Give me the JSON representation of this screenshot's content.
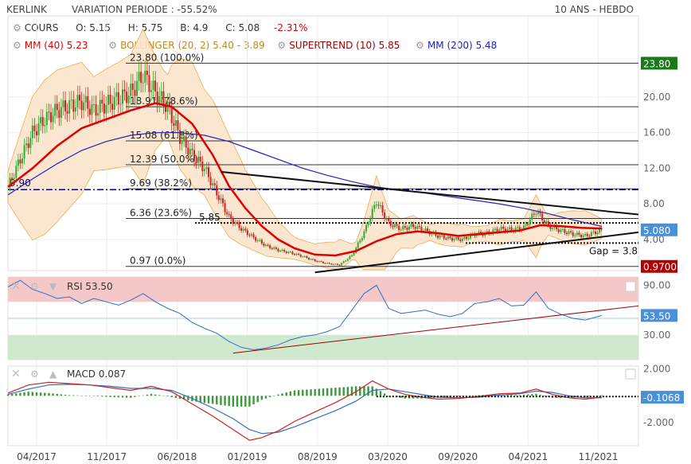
{
  "header": {
    "ticker": "KERLINK",
    "variation_label": "VARIATION PERIODE : -55.52%",
    "period": "10 ANS - HEBDO"
  },
  "legend": {
    "row1": {
      "cours": "COURS",
      "open": "O: 5.15",
      "high": "H: 5.75",
      "low": "B: 4.9",
      "close": "C: 5.08",
      "change": "-2.31%"
    },
    "row2": {
      "mm40_label": "MM (40)",
      "mm40_value": "5.23",
      "boll_label": "BOLLINGER (20, 2)",
      "boll_value": "5.40 - 3.89",
      "st_label": "SUPERTREND (10)",
      "st_value": "5.85",
      "mm200_label": "MM (200)",
      "mm200_value": "5.48"
    }
  },
  "colors": {
    "mm40": "#e00000",
    "bollinger": "#e8a030",
    "supertrend": "#a00000",
    "mm200": "#2020c0",
    "up": "#33aa33",
    "down": "#cc2222",
    "rsi_top": "#f4c8c8",
    "rsi_bottom": "#cfe9cf",
    "macd": "#cc2222",
    "signal": "#3070c0"
  },
  "chart_data": [
    {
      "type": "candlestick",
      "title": "KERLINK",
      "x_ticks": [
        "04/2017",
        "11/2017",
        "06/2018",
        "01/2019",
        "08/2019",
        "03/2020",
        "09/2020",
        "04/2021",
        "11/2021"
      ],
      "y_ticks": [
        "4.00",
        "8.00",
        "12.00",
        "16.00",
        "20.00"
      ],
      "ylim": [
        0.5,
        25
      ],
      "price_badges": {
        "max": "23.80",
        "last": "5.080",
        "min": "0.9700"
      },
      "left_label": "9.90",
      "fibonacci": [
        {
          "label": "23.80  (100.0%)",
          "value": 23.8
        },
        {
          "label": "18.91  (78.6%)",
          "value": 18.91
        },
        {
          "label": "15.08  (61.8%)",
          "value": 15.08
        },
        {
          "label": "12.39  (50.0%)",
          "value": 12.39
        },
        {
          "label": "9.69  (38.2%)",
          "value": 9.69
        },
        {
          "label": "6.36  (23.6%)",
          "value": 6.36
        },
        {
          "label": "0.97  (0.0%)",
          "value": 0.97
        }
      ],
      "supertrend_level": {
        "label": "5.85",
        "value": 5.85
      },
      "gap_label": "Gap = 3.8",
      "close_series": [
        [
          0,
          9.9
        ],
        [
          6,
          13
        ],
        [
          12,
          16
        ],
        [
          18,
          17.5
        ],
        [
          24,
          18.5
        ],
        [
          30,
          19
        ],
        [
          36,
          19.5
        ],
        [
          42,
          18.5
        ],
        [
          48,
          19.2
        ],
        [
          54,
          19.8
        ],
        [
          60,
          20.5
        ],
        [
          66,
          22.5
        ],
        [
          72,
          20.5
        ],
        [
          78,
          18.9
        ],
        [
          84,
          15.5
        ],
        [
          90,
          13.5
        ],
        [
          96,
          12
        ],
        [
          102,
          9.2
        ],
        [
          108,
          6.5
        ],
        [
          114,
          5.2
        ],
        [
          120,
          4.2
        ],
        [
          126,
          3.3
        ],
        [
          132,
          2.8
        ],
        [
          138,
          2.5
        ],
        [
          144,
          2.1
        ],
        [
          150,
          1.6
        ],
        [
          156,
          1.3
        ],
        [
          162,
          1.15
        ],
        [
          168,
          2.2
        ],
        [
          174,
          4.8
        ],
        [
          180,
          8.3
        ],
        [
          186,
          5.8
        ],
        [
          192,
          5.2
        ],
        [
          198,
          5.5
        ],
        [
          204,
          5.0
        ],
        [
          210,
          4.4
        ],
        [
          216,
          4.1
        ],
        [
          222,
          4.0
        ],
        [
          228,
          4.6
        ],
        [
          234,
          4.7
        ],
        [
          240,
          5.2
        ],
        [
          246,
          5.1
        ],
        [
          252,
          5.3
        ],
        [
          258,
          7.2
        ],
        [
          264,
          5.5
        ],
        [
          270,
          5.0
        ],
        [
          276,
          4.6
        ],
        [
          282,
          4.4
        ],
        [
          288,
          4.9
        ],
        [
          290,
          5.08
        ]
      ],
      "mm40": [
        [
          0,
          9.9
        ],
        [
          12,
          12
        ],
        [
          24,
          14.5
        ],
        [
          36,
          16.5
        ],
        [
          48,
          17.5
        ],
        [
          60,
          18.5
        ],
        [
          72,
          19.3
        ],
        [
          80,
          18.9
        ],
        [
          90,
          17
        ],
        [
          100,
          13.5
        ],
        [
          108,
          10
        ],
        [
          116,
          7.5
        ],
        [
          124,
          5.5
        ],
        [
          132,
          4
        ],
        [
          140,
          3
        ],
        [
          150,
          2.3
        ],
        [
          160,
          2.2
        ],
        [
          170,
          2.7
        ],
        [
          180,
          3.8
        ],
        [
          190,
          4.6
        ],
        [
          200,
          4.9
        ],
        [
          210,
          4.7
        ],
        [
          220,
          4.4
        ],
        [
          230,
          4.6
        ],
        [
          240,
          4.8
        ],
        [
          250,
          5.0
        ],
        [
          260,
          5.6
        ],
        [
          270,
          5.5
        ],
        [
          280,
          5.3
        ],
        [
          290,
          5.23
        ]
      ],
      "mm200": [
        [
          0,
          9.0
        ],
        [
          12,
          10.8
        ],
        [
          24,
          12.5
        ],
        [
          36,
          14.0
        ],
        [
          48,
          15.0
        ],
        [
          60,
          15.7
        ],
        [
          72,
          16.0
        ],
        [
          84,
          16.0
        ],
        [
          96,
          15.7
        ],
        [
          108,
          15.0
        ],
        [
          120,
          14.0
        ],
        [
          132,
          13.0
        ],
        [
          144,
          12.0
        ],
        [
          156,
          11.2
        ],
        [
          168,
          10.5
        ],
        [
          180,
          9.9
        ],
        [
          192,
          9.5
        ],
        [
          204,
          9.2
        ],
        [
          216,
          8.8
        ],
        [
          228,
          8.4
        ],
        [
          240,
          8.0
        ],
        [
          252,
          7.5
        ],
        [
          264,
          6.9
        ],
        [
          276,
          6.2
        ],
        [
          290,
          5.48
        ]
      ],
      "trendlines": [
        {
          "name": "upper",
          "from": [
            104,
            11.6
          ],
          "to": [
            308,
            6.8
          ]
        },
        {
          "name": "lower",
          "from": [
            150,
            0.3
          ],
          "to": [
            308,
            4.8
          ]
        }
      ]
    },
    {
      "type": "line",
      "title": "RSI",
      "value_label": "RSI 53.50",
      "badge": "53.50",
      "y_ticks": [
        "90.00",
        "30.00"
      ],
      "ylim": [
        0,
        100
      ],
      "zones": {
        "overbought": 70,
        "oversold": 30
      },
      "rsi_series": [
        [
          0,
          88
        ],
        [
          6,
          96
        ],
        [
          12,
          85
        ],
        [
          18,
          80
        ],
        [
          24,
          74
        ],
        [
          30,
          76
        ],
        [
          36,
          68
        ],
        [
          42,
          74
        ],
        [
          48,
          70
        ],
        [
          54,
          66
        ],
        [
          60,
          72
        ],
        [
          66,
          80
        ],
        [
          72,
          70
        ],
        [
          78,
          62
        ],
        [
          84,
          56
        ],
        [
          90,
          45
        ],
        [
          96,
          38
        ],
        [
          102,
          32
        ],
        [
          108,
          22
        ],
        [
          114,
          15
        ],
        [
          120,
          12
        ],
        [
          126,
          14
        ],
        [
          132,
          18
        ],
        [
          138,
          24
        ],
        [
          144,
          28
        ],
        [
          150,
          30
        ],
        [
          156,
          34
        ],
        [
          162,
          40
        ],
        [
          168,
          60
        ],
        [
          174,
          80
        ],
        [
          180,
          90
        ],
        [
          186,
          62
        ],
        [
          192,
          56
        ],
        [
          198,
          58
        ],
        [
          204,
          60
        ],
        [
          210,
          55
        ],
        [
          216,
          52
        ],
        [
          222,
          56
        ],
        [
          228,
          68
        ],
        [
          234,
          70
        ],
        [
          240,
          74
        ],
        [
          246,
          65
        ],
        [
          252,
          66
        ],
        [
          258,
          82
        ],
        [
          264,
          62
        ],
        [
          270,
          55
        ],
        [
          276,
          50
        ],
        [
          282,
          48
        ],
        [
          288,
          52
        ],
        [
          290,
          53.5
        ]
      ],
      "trendline": {
        "from": [
          110,
          8
        ],
        "to": [
          308,
          65
        ]
      }
    },
    {
      "type": "line",
      "title": "MACD",
      "value_label": "MACD 0.087",
      "badge": "-0.1068",
      "y_ticks": [
        "2.000",
        "-2.000"
      ],
      "ylim": [
        -3.7,
        2.2
      ],
      "macd_series": [
        [
          0,
          0.2
        ],
        [
          10,
          0.8
        ],
        [
          20,
          1.0
        ],
        [
          30,
          0.9
        ],
        [
          40,
          0.8
        ],
        [
          50,
          0.6
        ],
        [
          60,
          0.4
        ],
        [
          70,
          0.7
        ],
        [
          80,
          0.3
        ],
        [
          90,
          -0.6
        ],
        [
          100,
          -1.5
        ],
        [
          110,
          -2.5
        ],
        [
          118,
          -3.3
        ],
        [
          124,
          -3.1
        ],
        [
          132,
          -2.6
        ],
        [
          140,
          -1.9
        ],
        [
          150,
          -1.2
        ],
        [
          160,
          -0.5
        ],
        [
          170,
          0.3
        ],
        [
          178,
          1.1
        ],
        [
          186,
          0.5
        ],
        [
          194,
          0.1
        ],
        [
          202,
          -0.1
        ],
        [
          210,
          -0.25
        ],
        [
          220,
          -0.2
        ],
        [
          230,
          -0.05
        ],
        [
          240,
          0.15
        ],
        [
          250,
          0.2
        ],
        [
          258,
          0.5
        ],
        [
          266,
          0.1
        ],
        [
          274,
          -0.15
        ],
        [
          282,
          -0.25
        ],
        [
          290,
          -0.1
        ]
      ],
      "signal_series": [
        [
          0,
          0.1
        ],
        [
          10,
          0.5
        ],
        [
          20,
          0.8
        ],
        [
          30,
          0.85
        ],
        [
          40,
          0.8
        ],
        [
          50,
          0.7
        ],
        [
          60,
          0.55
        ],
        [
          70,
          0.55
        ],
        [
          80,
          0.4
        ],
        [
          90,
          -0.2
        ],
        [
          100,
          -0.9
        ],
        [
          110,
          -1.7
        ],
        [
          118,
          -2.5
        ],
        [
          124,
          -2.8
        ],
        [
          132,
          -2.7
        ],
        [
          140,
          -2.3
        ],
        [
          150,
          -1.7
        ],
        [
          160,
          -1.1
        ],
        [
          170,
          -0.4
        ],
        [
          178,
          0.4
        ],
        [
          186,
          0.5
        ],
        [
          194,
          0.3
        ],
        [
          202,
          0.1
        ],
        [
          210,
          -0.1
        ],
        [
          220,
          -0.15
        ],
        [
          230,
          -0.1
        ],
        [
          240,
          0.05
        ],
        [
          250,
          0.15
        ],
        [
          258,
          0.35
        ],
        [
          266,
          0.25
        ],
        [
          274,
          0.0
        ],
        [
          282,
          -0.15
        ],
        [
          290,
          -0.15
        ]
      ],
      "zero_label_dotted": true
    }
  ]
}
